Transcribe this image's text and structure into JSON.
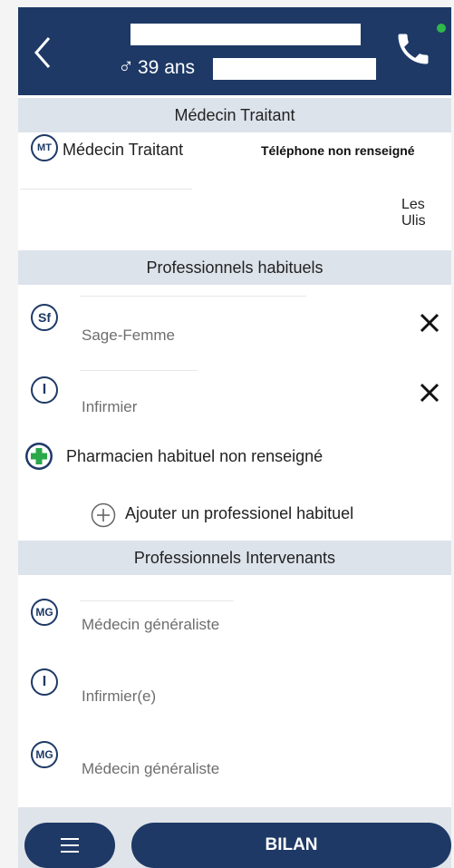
{
  "header": {
    "age_label": "39 ans",
    "gender_symbol": "♂",
    "colors": {
      "bg": "#1e3966",
      "online": "#2fb84a"
    },
    "icons": {
      "back": "chevron-left-icon",
      "phone": "phone-icon"
    }
  },
  "medecin_traitant": {
    "section_title": "Médecin Traitant",
    "badge": "MT",
    "label": "Médecin Traitant",
    "phone": "Téléphone non renseigné",
    "city": "Les Ulis"
  },
  "habituels": {
    "section_title": "Professionnels habituels",
    "items": [
      {
        "badge": "Sf",
        "role": "Sage-Femme",
        "remove_icon": "close-icon"
      },
      {
        "badge": "I",
        "role": "Infirmier",
        "remove_icon": "close-icon"
      }
    ],
    "pharmacien_label": "Pharmacien habituel non renseigné",
    "add_label": "Ajouter un professionel habituel"
  },
  "intervenants": {
    "section_title": "Professionnels Intervenants",
    "items": [
      {
        "badge": "MG",
        "role": "Médecin généraliste"
      },
      {
        "badge": "I",
        "role": "Infirmier(e)"
      },
      {
        "badge": "MG",
        "role": "Médecin généraliste"
      }
    ]
  },
  "bottom_bar": {
    "menu_icon": "menu-icon",
    "bilan_label": "BILAN"
  }
}
